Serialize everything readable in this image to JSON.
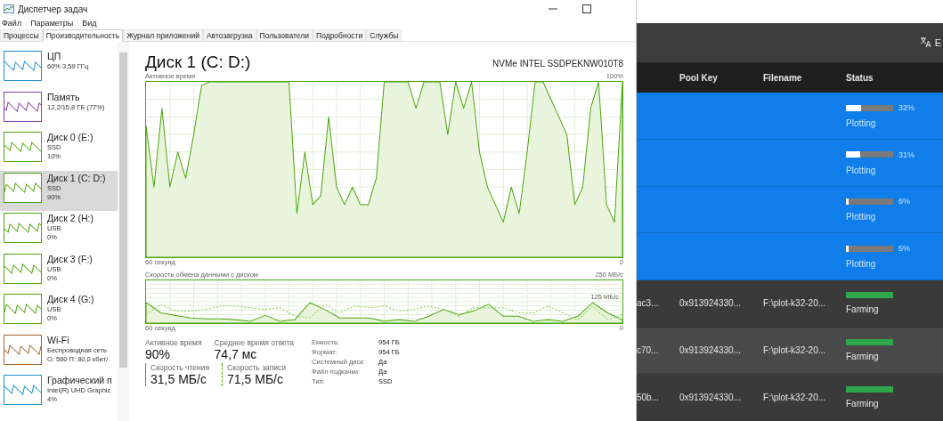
{
  "window": {
    "title": "Диспетчер задач"
  },
  "menu": [
    "Файл",
    "Параметры",
    "Вид"
  ],
  "tabs": [
    {
      "label": "Процессы",
      "selected": false
    },
    {
      "label": "Производительность",
      "selected": true
    },
    {
      "label": "Журнал приложений",
      "selected": false
    },
    {
      "label": "Автозагрузка",
      "selected": false
    },
    {
      "label": "Пользователи",
      "selected": false
    },
    {
      "label": "Подробности",
      "selected": false
    },
    {
      "label": "Службы",
      "selected": false
    }
  ],
  "sidebar": {
    "items": [
      {
        "name": "ЦП",
        "line_1": "60% 3,59 ГГц",
        "color": "#1d8fc9",
        "selected": false
      },
      {
        "name": "Память",
        "line_1": "12,2/15,8 ГБ (77%)",
        "color": "#8b3fa8",
        "selected": false
      },
      {
        "name": "Диск 0 (E:)",
        "line_1": "SSD",
        "line_2": "10%",
        "color": "#4da60c",
        "selected": false
      },
      {
        "name": "Диск 1 (C: D:)",
        "line_1": "SSD",
        "line_2": "90%",
        "color": "#4da60c",
        "selected": true
      },
      {
        "name": "Диск 2 (H:)",
        "line_1": "USB",
        "line_2": "0%",
        "color": "#4da60c",
        "selected": false
      },
      {
        "name": "Диск 3 (F:)",
        "line_1": "USB",
        "line_2": "0%",
        "color": "#4da60c",
        "selected": false
      },
      {
        "name": "Диск 4 (G:)",
        "line_1": "USB",
        "line_2": "0%",
        "color": "#4da60c",
        "selected": false
      },
      {
        "name": "Wi-Fi",
        "line_1": "Беспроводная сеть",
        "line_2": "О: 560 П: 80,0 кбит/",
        "color": "#a7652d",
        "selected": false
      },
      {
        "name": "Графический п",
        "line_1": "Intel(R) UHD Graphic",
        "line_2": "4%",
        "color": "#1d8fc9",
        "selected": false
      }
    ]
  },
  "main": {
    "title": "Диск 1 (C: D:)",
    "model": "NVMe INTEL SSDPEKNW010T8",
    "active_chart": {
      "title": "Активное время",
      "top_label": "100%",
      "start_label": "60 секунд",
      "end_label": "0"
    },
    "transfer_chart": {
      "title": "Скорость обмена данными с диском",
      "top_label": "250 МБ/с",
      "mid_label": "125 МБ/с",
      "start_label": "60 секунд",
      "end_label": "0"
    },
    "stats": [
      {
        "label": "Активное время",
        "value": "90%"
      },
      {
        "label": "Среднее время ответа",
        "value": "74,7 мс"
      }
    ],
    "speeds": [
      {
        "label": "Скорость чтения",
        "value": "31,5 МБ/с",
        "kind": "read"
      },
      {
        "label": "Скорость записи",
        "value": "71,5 МБ/с",
        "kind": "write"
      }
    ],
    "properties": [
      {
        "label": "Емкость:",
        "value": "954 ГБ"
      },
      {
        "label": "Формат:",
        "value": "954 ГБ"
      },
      {
        "label": "Системный диск:",
        "value": "Да"
      },
      {
        "label": "Файл подкачки:",
        "value": "Да"
      },
      {
        "label": "Тип:",
        "value": "SSD"
      }
    ]
  },
  "plot_app": {
    "language_button": "E",
    "table": {
      "columns": [
        "Pool Key",
        "Filename",
        "Status"
      ],
      "rows": [
        {
          "kind": "plotting",
          "status": "Plotting",
          "level": 0.32,
          "percent": "32%"
        },
        {
          "kind": "plotting",
          "status": "Plotting",
          "level": 0.31,
          "percent": "31%"
        },
        {
          "kind": "plotting",
          "status": "Plotting",
          "level": 0.06,
          "percent": "6%"
        },
        {
          "kind": "plotting",
          "status": "Plotting",
          "level": 0.05,
          "percent": "5%"
        },
        {
          "kind": "farming",
          "column_1": "ac3...",
          "pool_key": "0x913924330...",
          "filename": "F:\\plot-k32-20...",
          "status": "Farming",
          "level": 1
        },
        {
          "kind": "farming",
          "column_1": "c70...",
          "pool_key": "0x913924330...",
          "filename": "F:\\plot-k32-20...",
          "status": "Farming",
          "level": 1
        },
        {
          "kind": "farming",
          "column_1": "50b...",
          "pool_key": "0x913924330...",
          "filename": "F:\\plot-k32-20...",
          "status": "Farming",
          "level": 1
        }
      ]
    }
  }
}
